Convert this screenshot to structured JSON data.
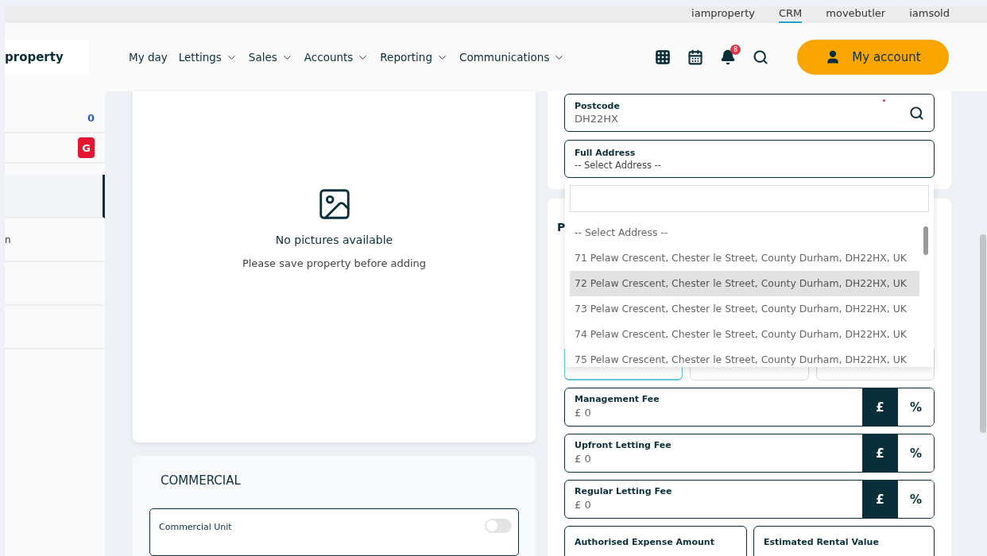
{
  "portal_links": [
    {
      "label": "iamproperty",
      "selected": false
    },
    {
      "label": "CRM",
      "selected": true
    },
    {
      "label": "movebutler",
      "selected": false
    },
    {
      "label": "iamsold",
      "selected": false
    }
  ],
  "logo": {
    "text": "property"
  },
  "nav": [
    {
      "label": "My day",
      "dropdown": false
    },
    {
      "label": "Lettings",
      "dropdown": true
    },
    {
      "label": "Sales",
      "dropdown": true
    },
    {
      "label": "Accounts",
      "dropdown": true
    },
    {
      "label": "Reporting",
      "dropdown": true
    },
    {
      "label": "Communications",
      "dropdown": true
    }
  ],
  "toolbar": {
    "notification_count": "8",
    "account_button": "My account"
  },
  "sidebar": {
    "items": [
      {
        "kind": "count",
        "text": "0",
        "selected": false
      },
      {
        "kind": "badge",
        "text": "G",
        "selected": false
      },
      {
        "kind": "plain",
        "selected": true
      },
      {
        "kind": "plain",
        "text": "n",
        "selected": false
      },
      {
        "kind": "plain",
        "selected": false
      },
      {
        "kind": "plain",
        "selected": false
      }
    ]
  },
  "pictures": {
    "title": "No pictures available",
    "subtitle": "Please save property before adding"
  },
  "commercial": {
    "title": "COMMERCIAL",
    "fields": [
      {
        "label": "Commercial Unit",
        "on": false
      }
    ]
  },
  "address": {
    "postcode": {
      "label": "Postcode",
      "value": "DH22HX"
    },
    "full_address": {
      "label": "Full Address",
      "value": "-- Select Address --"
    }
  },
  "address_dropdown": {
    "options": [
      {
        "text": "-- Select Address --",
        "selected": false
      },
      {
        "text": "71 Pelaw Crescent, Chester le Street, County Durham, DH22HX, UK",
        "selected": false
      },
      {
        "text": "72 Pelaw Crescent, Chester le Street, County Durham, DH22HX, UK",
        "selected": true
      },
      {
        "text": "73 Pelaw Crescent, Chester le Street, County Durham, DH22HX, UK",
        "selected": false
      },
      {
        "text": "74 Pelaw Crescent, Chester le Street, County Durham, DH22HX, UK",
        "selected": false
      },
      {
        "text": "75 Pelaw Crescent, Chester le Street, County Durham, DH22HX, UK",
        "selected": false
      }
    ]
  },
  "fees_section": {
    "heading": "P",
    "option_boxes": [
      {
        "selected": true
      },
      {
        "selected": false
      },
      {
        "selected": false
      }
    ],
    "fee_fields": [
      {
        "label": "Management Fee",
        "value": "£ 0",
        "unit_options": [
          {
            "label": "£",
            "selected": true
          },
          {
            "label": "%",
            "selected": false
          }
        ]
      },
      {
        "label": "Upfront Letting Fee",
        "value": "£ 0",
        "unit_options": [
          {
            "label": "£",
            "selected": true
          },
          {
            "label": "%",
            "selected": false
          }
        ]
      },
      {
        "label": "Regular Letting Fee",
        "value": "£ 0",
        "unit_options": [
          {
            "label": "£",
            "selected": true
          },
          {
            "label": "%",
            "selected": false
          }
        ]
      }
    ],
    "half_fields": [
      {
        "label": "Authorised Expense Amount"
      },
      {
        "label": "Estimated Rental Value"
      }
    ]
  }
}
